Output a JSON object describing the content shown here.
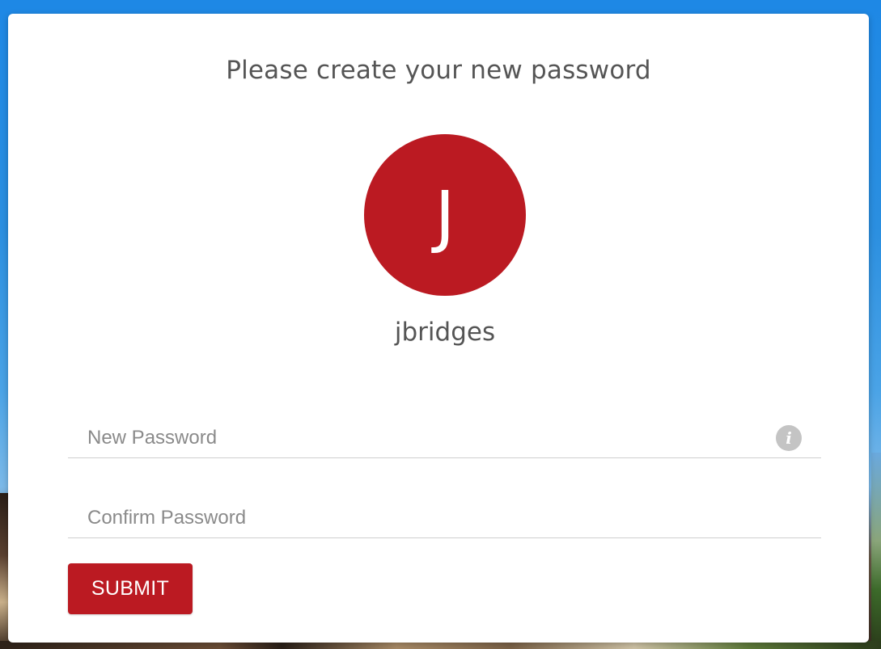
{
  "form": {
    "title": "Please create your new password",
    "avatar": {
      "initial": "J",
      "color": "#bb1a22"
    },
    "username": "jbridges",
    "fields": {
      "new_password": {
        "placeholder": "New Password",
        "value": "",
        "info_icon": "info-icon"
      },
      "confirm_password": {
        "placeholder": "Confirm Password",
        "value": ""
      }
    },
    "submit_label": "SUBMIT",
    "accent_color": "#bb1a22"
  }
}
